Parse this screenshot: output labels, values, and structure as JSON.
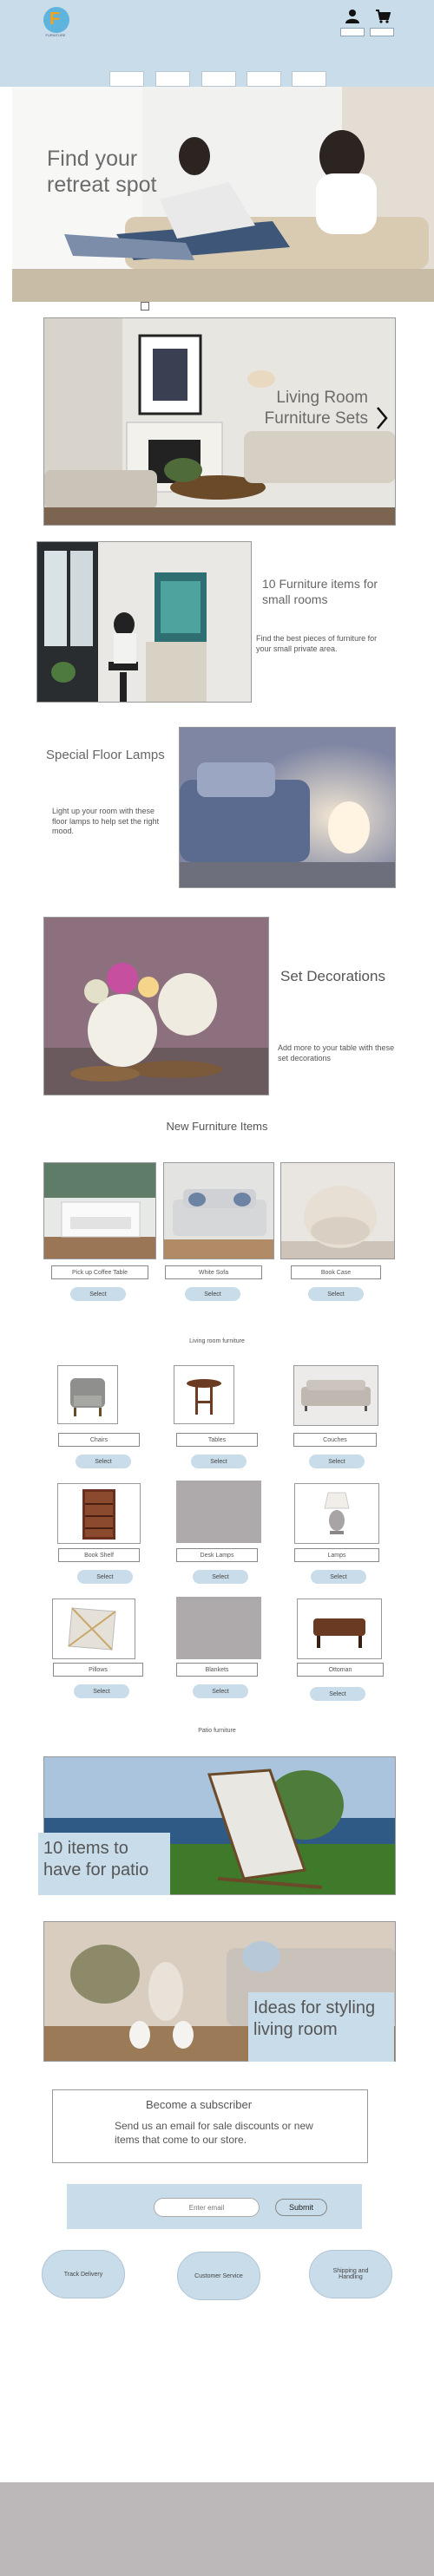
{
  "header": {
    "logo_letter": "F",
    "logo_text": "FURNITURE",
    "user_icon": "user-icon",
    "cart_icon": "cart-icon",
    "nav_count": 5
  },
  "hero": {
    "title": "Find your retreat spot"
  },
  "living_room": {
    "title": "Living Room Furniture Sets",
    "arrow_icon": "chevron-right-icon"
  },
  "small_rooms": {
    "title": "10 Furniture items for small rooms",
    "subtitle": "Find the best pieces of furniture for your small private area."
  },
  "lamps": {
    "title": "Special Floor Lamps",
    "subtitle": "Light up your room with these floor lamps to help set the right mood."
  },
  "decorations": {
    "title": "Set Decorations",
    "subtitle": "Add more to your table with these set decorations"
  },
  "new_items": {
    "title": "New Furniture Items",
    "items": [
      {
        "label": "Pick up Coffee Table",
        "button": "Select"
      },
      {
        "label": "White Sofa",
        "button": "Select"
      },
      {
        "label": "Book Case",
        "button": "Select"
      }
    ]
  },
  "living_room_furniture": {
    "heading": "Living room furniture",
    "items": [
      {
        "label": "Chairs",
        "button": "Select"
      },
      {
        "label": "Tables",
        "button": "Select"
      },
      {
        "label": "Couches",
        "button": "Select"
      },
      {
        "label": "Book Shelf",
        "button": "Select"
      },
      {
        "label": "Desk Lamps",
        "button": "Select"
      },
      {
        "label": "Lamps",
        "button": "Select"
      },
      {
        "label": "Pillows",
        "button": "Select"
      },
      {
        "label": "Blankets",
        "button": "Select"
      },
      {
        "label": "Ottoman",
        "button": "Select"
      }
    ]
  },
  "patio": {
    "heading": "Patio furniture",
    "title": "10 items to have for patio"
  },
  "styling": {
    "title": "Ideas for styling living room"
  },
  "subscribe": {
    "title": "Become a subscriber",
    "text": "Send us an email for sale discounts or new items that come to our store.",
    "email_placeholder": "Enter email",
    "submit": "Submit"
  },
  "footer": {
    "links": [
      "Track Delivery",
      "Customer Service",
      "Shipping and Handling"
    ]
  },
  "colors": {
    "header_bg": "#c9dcea",
    "footer_bg": "#bcb8b9"
  }
}
